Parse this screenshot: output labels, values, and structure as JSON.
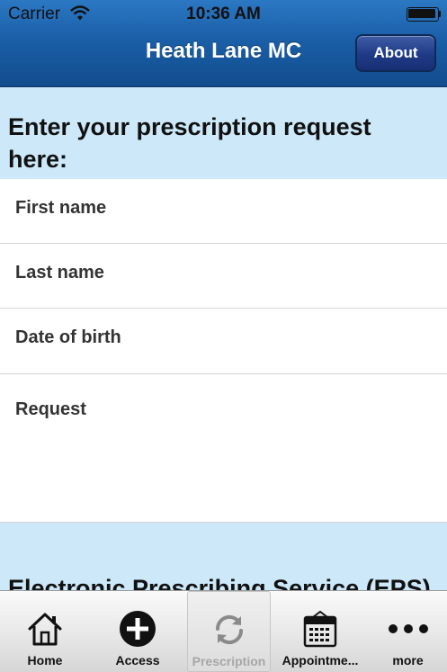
{
  "status_bar": {
    "carrier": "Carrier",
    "time": "10:36 AM"
  },
  "nav_bar": {
    "title": "Heath Lane MC",
    "about_label": "About"
  },
  "form": {
    "heading": "Enter your prescription request here:",
    "fields": {
      "first_name": "First name",
      "last_name": "Last name",
      "dob": "Date of birth",
      "request": "Request"
    }
  },
  "eps": {
    "heading": "Electronic Prescribing Service (EPS)"
  },
  "tabs": [
    {
      "label": "Home",
      "icon": "home-icon"
    },
    {
      "label": "Access",
      "icon": "plus-circle-icon"
    },
    {
      "label": "Prescription",
      "icon": "refresh-icon"
    },
    {
      "label": "Appointme...",
      "icon": "calendar-icon"
    },
    {
      "label": "more",
      "icon": "more-icon"
    }
  ],
  "selected_tab": "Prescription"
}
